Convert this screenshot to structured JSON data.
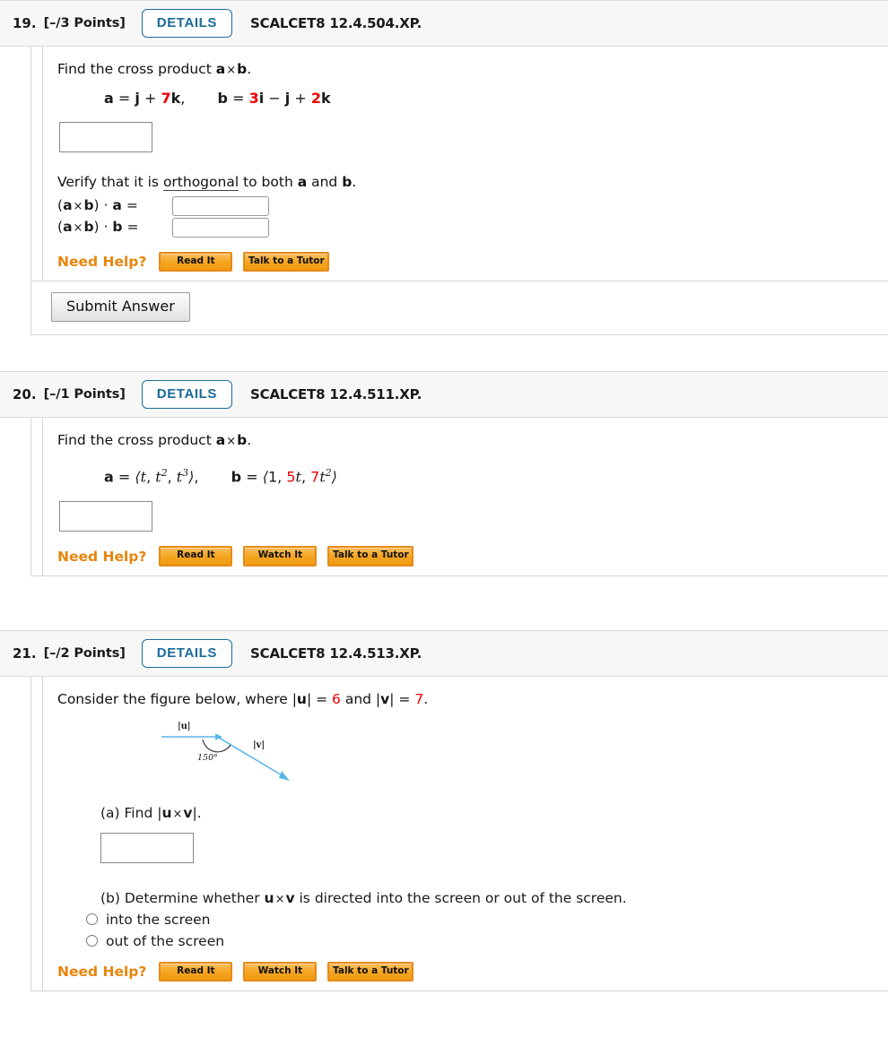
{
  "problems": [
    {
      "number": "19.",
      "points": "[–/3 Points]",
      "details_label": "DETAILS",
      "code": "SCALCET8 12.4.504.XP.",
      "prompt_pre": "Find the cross product ",
      "prompt_a": "a",
      "prompt_times": "×",
      "prompt_b": "b",
      "prompt_post": ".",
      "math": {
        "a_label": "a",
        "eq": "=",
        "a_expr_1": "j",
        "a_plus": "+",
        "a_coeff": "7",
        "a_k": "k",
        "comma": ",",
        "b_label": "b",
        "b_coeff1": "3",
        "b_i": "i",
        "b_minus": "−",
        "b_j": "j",
        "b_plus": "+",
        "b_coeff2": "2",
        "b_k": "k"
      },
      "verify_pre": "Verify that it is ",
      "verify_link": "orthogonal",
      "verify_mid": " to both ",
      "verify_a": "a",
      "verify_and": " and ",
      "verify_b": "b",
      "verify_post": ".",
      "ortho_rows": [
        {
          "lhs_open": "(",
          "a": "a",
          "times": "×",
          "b": "b",
          "close": ")",
          "dot": "·",
          "target": "a",
          "eq": "="
        },
        {
          "lhs_open": "(",
          "a": "a",
          "times": "×",
          "b": "b",
          "close": ")",
          "dot": "·",
          "target": "b",
          "eq": "="
        }
      ],
      "need_help_label": "Need Help?",
      "help_buttons": [
        "Read It",
        "Talk to a Tutor"
      ],
      "submit_label": "Submit Answer"
    },
    {
      "number": "20.",
      "points": "[–/1 Points]",
      "details_label": "DETAILS",
      "code": "SCALCET8 12.4.511.XP.",
      "prompt_pre": "Find the cross product ",
      "prompt_a": "a",
      "prompt_times": "×",
      "prompt_b": "b",
      "prompt_post": ".",
      "math": {
        "a_label": "a",
        "eq": "=",
        "open": "⟨",
        "t1": "t",
        "c1": ", ",
        "t2": "t",
        "e2": "2",
        "c2": ", ",
        "t3": "t",
        "e3": "3",
        "close": "⟩",
        "comma": ",",
        "b_label": "b",
        "b_open": "⟨",
        "b1": "1",
        "b_c1": ", ",
        "b_coeff2": "5",
        "b_t2": "t",
        "b_c2": ", ",
        "b_coeff3": "7",
        "b_t3": "t",
        "b_e3": "2",
        "b_close": "⟩"
      },
      "need_help_label": "Need Help?",
      "help_buttons": [
        "Read It",
        "Watch It",
        "Talk to a Tutor"
      ]
    },
    {
      "number": "21.",
      "points": "[–/2 Points]",
      "details_label": "DETAILS",
      "code": "SCALCET8 12.4.513.XP.",
      "prompt_pre": "Consider the figure below, where |",
      "prompt_u": "u",
      "prompt_mid1": "| = ",
      "u_value": "6",
      "prompt_mid2": " and |",
      "prompt_v": "v",
      "prompt_mid3": "| = ",
      "v_value": "7",
      "prompt_post": ".",
      "figure": {
        "u_label": "|u|",
        "v_label": "|v|",
        "angle_label": "150°",
        "vector_color": "#5bb7e8"
      },
      "part_a": {
        "tag": "(a) Find |",
        "u": "u",
        "times": "×",
        "v": "v",
        "post": "|."
      },
      "part_b": {
        "pre": "(b) Determine whether ",
        "u": "u",
        "times": "×",
        "v": "v",
        "post": " is directed into the screen or out of the screen.",
        "options": [
          "into the screen",
          "out of the screen"
        ]
      },
      "need_help_label": "Need Help?",
      "help_buttons": [
        "Read It",
        "Watch It",
        "Talk to a Tutor"
      ]
    }
  ]
}
